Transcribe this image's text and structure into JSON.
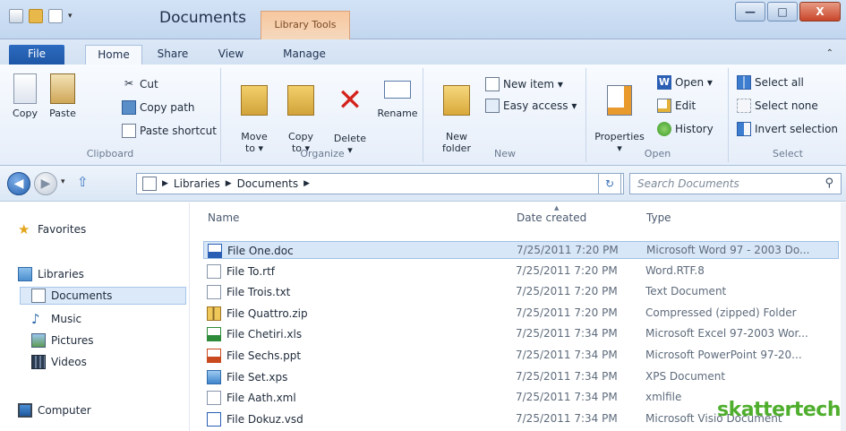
{
  "window": {
    "title": "Documents",
    "contextual_tab": "Library Tools",
    "minimize": "—",
    "maximize": "□",
    "close": "X"
  },
  "ribbon_tabs": [
    "File",
    "Home",
    "Share",
    "View",
    "Manage"
  ],
  "ribbon": {
    "clipboard": {
      "label": "Clipboard",
      "copy": "Copy",
      "paste": "Paste",
      "cut": "Cut",
      "copy_path": "Copy path",
      "paste_shortcut": "Paste shortcut"
    },
    "organize": {
      "label": "Organize",
      "move_to": "Move\nto ▾",
      "copy_to": "Copy\nto ▾",
      "delete": "Delete\n▾",
      "rename": "Rename"
    },
    "new": {
      "label": "New",
      "new_folder": "New\nfolder",
      "new_item": "New item ▾",
      "easy_access": "Easy access ▾"
    },
    "open": {
      "label": "Open",
      "properties": "Properties\n▾",
      "open": "Open ▾",
      "edit": "Edit",
      "history": "History"
    },
    "select": {
      "label": "Select",
      "select_all": "Select all",
      "select_none": "Select none",
      "invert_selection": "Invert selection"
    }
  },
  "address": {
    "segments": [
      "Libraries",
      "Documents"
    ],
    "search_placeholder": "Search Documents"
  },
  "navpane": {
    "favorites": "Favorites",
    "libraries": "Libraries",
    "library_items": [
      "Documents",
      "Music",
      "Pictures",
      "Videos"
    ],
    "computer": "Computer"
  },
  "columns": {
    "name": "Name",
    "date": "Date created",
    "type": "Type"
  },
  "files": [
    {
      "name": "File One.doc",
      "date": "7/25/2011 7:20 PM",
      "type": "Microsoft Word 97 - 2003 Do...",
      "icon": "word-doc-icon"
    },
    {
      "name": "File To.rtf",
      "date": "7/25/2011 7:20 PM",
      "type": "Word.RTF.8",
      "icon": "rtf-icon"
    },
    {
      "name": "File Trois.txt",
      "date": "7/25/2011 7:20 PM",
      "type": "Text Document",
      "icon": "text-file-icon"
    },
    {
      "name": "File Quattro.zip",
      "date": "7/25/2011 7:20 PM",
      "type": "Compressed (zipped) Folder",
      "icon": "zip-folder-icon"
    },
    {
      "name": "File Chetiri.xls",
      "date": "7/25/2011 7:34 PM",
      "type": "Microsoft Excel 97-2003 Wor...",
      "icon": "excel-icon"
    },
    {
      "name": "File Sechs.ppt",
      "date": "7/25/2011 7:34 PM",
      "type": "Microsoft PowerPoint 97-20...",
      "icon": "powerpoint-icon"
    },
    {
      "name": "File Set.xps",
      "date": "7/25/2011 7:34 PM",
      "type": "XPS Document",
      "icon": "xps-icon"
    },
    {
      "name": "File Aath.xml",
      "date": "7/25/2011 7:34 PM",
      "type": "xmlfile",
      "icon": "xml-icon"
    },
    {
      "name": "File Dokuz.vsd",
      "date": "7/25/2011 7:34 PM",
      "type": "Microsoft Visio Document",
      "icon": "visio-icon"
    }
  ],
  "watermark": "skattertech",
  "colors": {
    "accent": "#1f57a6",
    "selection": "#d8e7f8",
    "contextual": "#f5d8bd",
    "watermark": "#4fae2d"
  }
}
